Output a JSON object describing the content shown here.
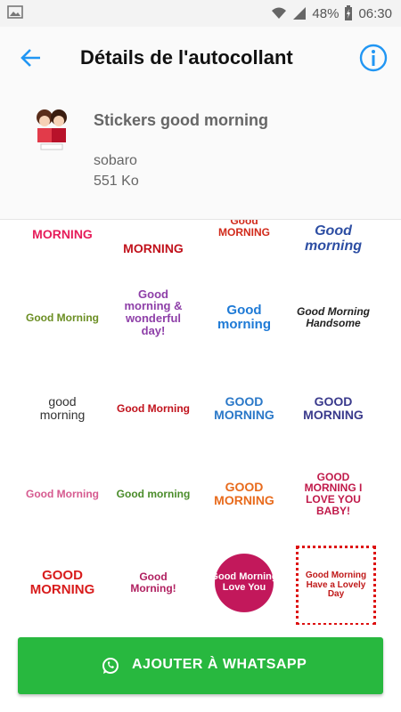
{
  "status": {
    "battery": "48%",
    "time": "06:30"
  },
  "header": {
    "title": "Détails de l'autocollant"
  },
  "pack": {
    "name": "Stickers good morning",
    "author": "sobaro",
    "size": "551 Ko"
  },
  "stickers": [
    {
      "text": "MORNING",
      "color": "#e61d5a"
    },
    {
      "text": "MORNING",
      "color": "#c1121c"
    },
    {
      "text": "Good MORNING",
      "color": "#d12a1b"
    },
    {
      "text": "Good morning",
      "color": "#2d4ea3"
    },
    {
      "text": "Good Morning",
      "color": "#6b8e23"
    },
    {
      "text": "Good morning & wonderful day!",
      "color": "#8e3fa8"
    },
    {
      "text": "Good morning",
      "color": "#1e7ad6"
    },
    {
      "text": "Good Morning Handsome",
      "color": "#222222"
    },
    {
      "text": "good morning",
      "color": "#333333"
    },
    {
      "text": "Good Morning",
      "color": "#c1121c"
    },
    {
      "text": "GOOD MORNING",
      "color": "#2a78c8"
    },
    {
      "text": "GOOD MORNING",
      "color": "#3a3a8c"
    },
    {
      "text": "Good Morning",
      "color": "#d65a8f"
    },
    {
      "text": "Good morning",
      "color": "#4a8c2a"
    },
    {
      "text": "GOOD MORNING",
      "color": "#e86b1d"
    },
    {
      "text": "GOOD MORNING I LOVE YOU BABY!",
      "color": "#c01a4a"
    },
    {
      "text": "GOOD MORNING",
      "color": "#d81c1c"
    },
    {
      "text": "Good Morning!",
      "color": "#b02060"
    },
    {
      "text": "Good Morning Love You",
      "color": "#ffffff"
    },
    {
      "text": "Good Morning Have a Lovely Day",
      "color": "#c01a1a"
    }
  ],
  "button": {
    "label": "AJOUTER À WHATSAPP"
  },
  "colors": {
    "accent": "#2196f3",
    "button": "#28b83f"
  }
}
